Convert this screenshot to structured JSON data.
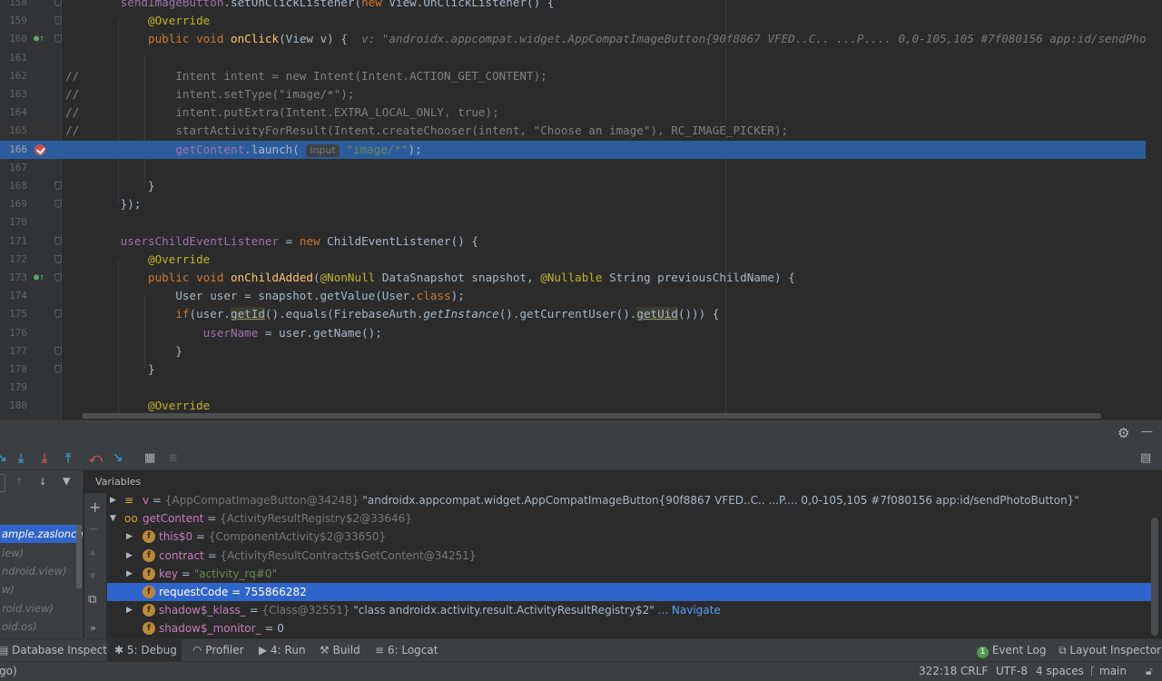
{
  "editor": {
    "lines": [
      {
        "n": "158",
        "html": "        <span class=\"fd\">sendImageButton</span>.setOnClickListener(<span class=\"k\">new </span>View.OnClickListener() {"
      },
      {
        "n": "159",
        "html": "            <span class=\"a\">@Override</span>"
      },
      {
        "n": "160",
        "html": "            <span class=\"k\">public void </span><span class=\"fn\">onClick</span>(View v) {  <span class=\"hint\">v: \"androidx.appcompat.widget.AppCompatImageButton{90f8867 VFED..C.. ...P.... 0,0-105,105 #7f080156 app:id/sendPhotoButton}\"</span>"
      },
      {
        "n": "161",
        "html": ""
      },
      {
        "n": "162",
        "html": "<span class=\"c\">//              Intent intent = new Intent(Intent.ACTION_GET_CONTENT);</span>"
      },
      {
        "n": "163",
        "html": "<span class=\"c\">//              intent.setType(\"image/*\");</span>"
      },
      {
        "n": "164",
        "html": "<span class=\"c\">//              intent.putExtra(Intent.EXTRA_LOCAL_ONLY, true);</span>"
      },
      {
        "n": "165",
        "html": "<span class=\"c\">//              startActivityForResult(Intent.createChooser(intent, \"Choose an image\"), RC_IMAGE_PICKER);</span>"
      },
      {
        "n": "166",
        "html": "                <span class=\"fd\">getContent</span>.launch( <span class=\"ph\">input</span> <span class=\"s\">\"image/*\"</span>);"
      },
      {
        "n": "167",
        "html": ""
      },
      {
        "n": "168",
        "html": "            }"
      },
      {
        "n": "169",
        "html": "        });"
      },
      {
        "n": "170",
        "html": ""
      },
      {
        "n": "171",
        "html": "        <span class=\"fd\">usersChildEventListener</span> = <span class=\"k\">new </span>ChildEventListener() {"
      },
      {
        "n": "172",
        "html": "            <span class=\"a\">@Override</span>"
      },
      {
        "n": "173",
        "html": "            <span class=\"k\">public void </span><span class=\"fn\">onChildAdded</span>(<span class=\"a\">@NonNull </span>DataSnapshot snapshot, <span class=\"a\">@Nullable </span>String previousChildName) {"
      },
      {
        "n": "174",
        "html": "                User user = snapshot.getValue(User.<span class=\"k\">class</span>);"
      },
      {
        "n": "175",
        "html": "                <span class=\"k\">if</span>(user.<span class=\"u\">getId</span>().equals(FirebaseAuth.<span class=\"it\">getInstance</span>().getCurrentUser().<span class=\"u\">getUid</span>())) {"
      },
      {
        "n": "176",
        "html": "                    <span class=\"fd\">userName</span> = user.getName();"
      },
      {
        "n": "177",
        "html": "                }"
      },
      {
        "n": "178",
        "html": "            }"
      },
      {
        "n": "179",
        "html": ""
      },
      {
        "n": "180",
        "html": "            <span class=\"a\">@Override</span>"
      }
    ]
  },
  "debug": {
    "gear": "⚙",
    "minimize": "—",
    "toolbar_icons": [
      "step-over-icon",
      "step-into-icon",
      "force-step-into-icon",
      "step-out-icon",
      "drop-frame-icon",
      "run-to-cursor-icon",
      "evaluate-icon",
      "trace-icon"
    ],
    "frames": [
      "",
      "ample.zaslonchat",
      "iew)",
      "ndroid.view)",
      "w)",
      "roid.view)",
      "oid.os)"
    ],
    "variables_label": "Variables",
    "vars": [
      {
        "indent": 0,
        "arrow": "▶",
        "icon": "≡",
        "html": "<span class=\"vn\">v</span> = <span class=\"vt\">{AppCompatImageButton@34248}</span> \"androidx.appcompat.widget.AppCompatImageButton{90f8867 VFED..C.. ...P.... 0,0-105,105 #7f080156 app:id/sendPhotoButton}\""
      },
      {
        "indent": 0,
        "arrow": "▼",
        "icon": "oo",
        "html": "<span class=\"vn\">getContent</span> = <span class=\"vt\">{ActivityResultRegistry$2@33646}</span>"
      },
      {
        "indent": 1,
        "arrow": "▶",
        "icon": "f",
        "html": "<span class=\"vn\">this$0</span> = <span class=\"vt\">{ComponentActivity$2@33650}</span>"
      },
      {
        "indent": 1,
        "arrow": "▶",
        "icon": "f",
        "html": "<span class=\"vn\">contract</span> = <span class=\"vt\">{ActivityResultContracts$GetContent@34251}</span>"
      },
      {
        "indent": 1,
        "arrow": "▶",
        "icon": "f",
        "html": "<span class=\"vn\">key</span> = <span class=\"s\">\"activity_rq#0\"</span>"
      },
      {
        "indent": 1,
        "arrow": "",
        "icon": "f",
        "html": "<span style=\"color:#fff\">requestCode = 755866282</span>",
        "sel": true
      },
      {
        "indent": 1,
        "arrow": "▶",
        "icon": "f",
        "html": "<span class=\"vn\">shadow$_klass_</span> = <span class=\"vt\">{Class@32551}</span> \"class androidx.activity.result.ActivityResultRegistry$2\" <span class=\"nav\">... Navigate</span>"
      },
      {
        "indent": 1,
        "arrow": "",
        "icon": "f",
        "html": "<span class=\"vn\">shadow$_monitor_</span> = 0"
      }
    ]
  },
  "toolwindows": {
    "database": "Database Inspector",
    "debug": "5: Debug",
    "profiler": "Profiler",
    "run": "4: Run",
    "build": "Build",
    "logcat": "6: Logcat",
    "eventlog": "Event Log",
    "eventlog_badge": "1",
    "layout": "Layout Inspector"
  },
  "status": {
    "left": "go)",
    "position": "322:18",
    "line_sep": "CRLF",
    "encoding": "UTF-8",
    "indent": "4 spaces",
    "branch": "main"
  }
}
